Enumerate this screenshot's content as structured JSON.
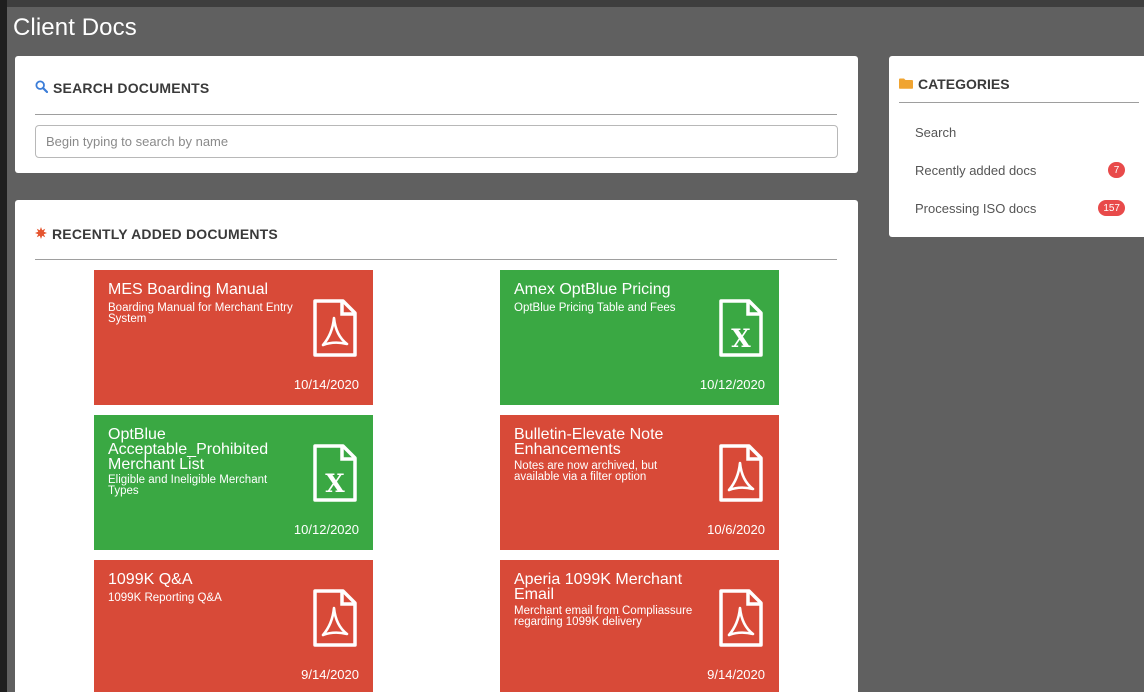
{
  "app": {
    "title": "Client Docs"
  },
  "search": {
    "heading": "SEARCH DOCUMENTS",
    "placeholder": "Begin typing to search by name",
    "value": ""
  },
  "categories": {
    "heading": "CATEGORIES",
    "items": [
      {
        "label": "Search",
        "count": ""
      },
      {
        "label": "Recently added docs",
        "count": "7"
      },
      {
        "label": "Processing ISO docs",
        "count": "157"
      }
    ]
  },
  "recent": {
    "heading": "RECENTLY ADDED DOCUMENTS",
    "documents": [
      {
        "title": "MES Boarding Manual",
        "description": "Boarding Manual for Merchant Entry System",
        "date": "10/14/2020",
        "type": "pdf"
      },
      {
        "title": "Amex OptBlue Pricing",
        "description": "OptBlue Pricing Table and Fees",
        "date": "10/12/2020",
        "type": "excel"
      },
      {
        "title": "OptBlue Acceptable_Prohibited Merchant List",
        "description": "Eligible and Ineligible Merchant Types",
        "date": "10/12/2020",
        "type": "excel"
      },
      {
        "title": "Bulletin-Elevate Note Enhancements",
        "description": "Notes are now archived, but available via a filter option",
        "date": "10/6/2020",
        "type": "pdf"
      },
      {
        "title": "1099K Q&A",
        "description": "1099K Reporting Q&A",
        "date": "9/14/2020",
        "type": "pdf"
      },
      {
        "title": "Aperia 1099K Merchant Email",
        "description": "Merchant email from Compliassure regarding 1099K delivery",
        "date": "9/14/2020",
        "type": "pdf"
      }
    ]
  },
  "colors": {
    "pdf_tile": "#d84a38",
    "excel_tile": "#3aa843",
    "accent_blue": "#3b7dd8",
    "folder_orange": "#f0a431",
    "badge_red": "#e84a4a"
  },
  "icons": {
    "search_heading": "search-icon",
    "categories_heading": "folder-icon",
    "recent_heading": "starburst-icon",
    "pdf": "pdf-file-icon",
    "excel": "excel-file-icon"
  }
}
